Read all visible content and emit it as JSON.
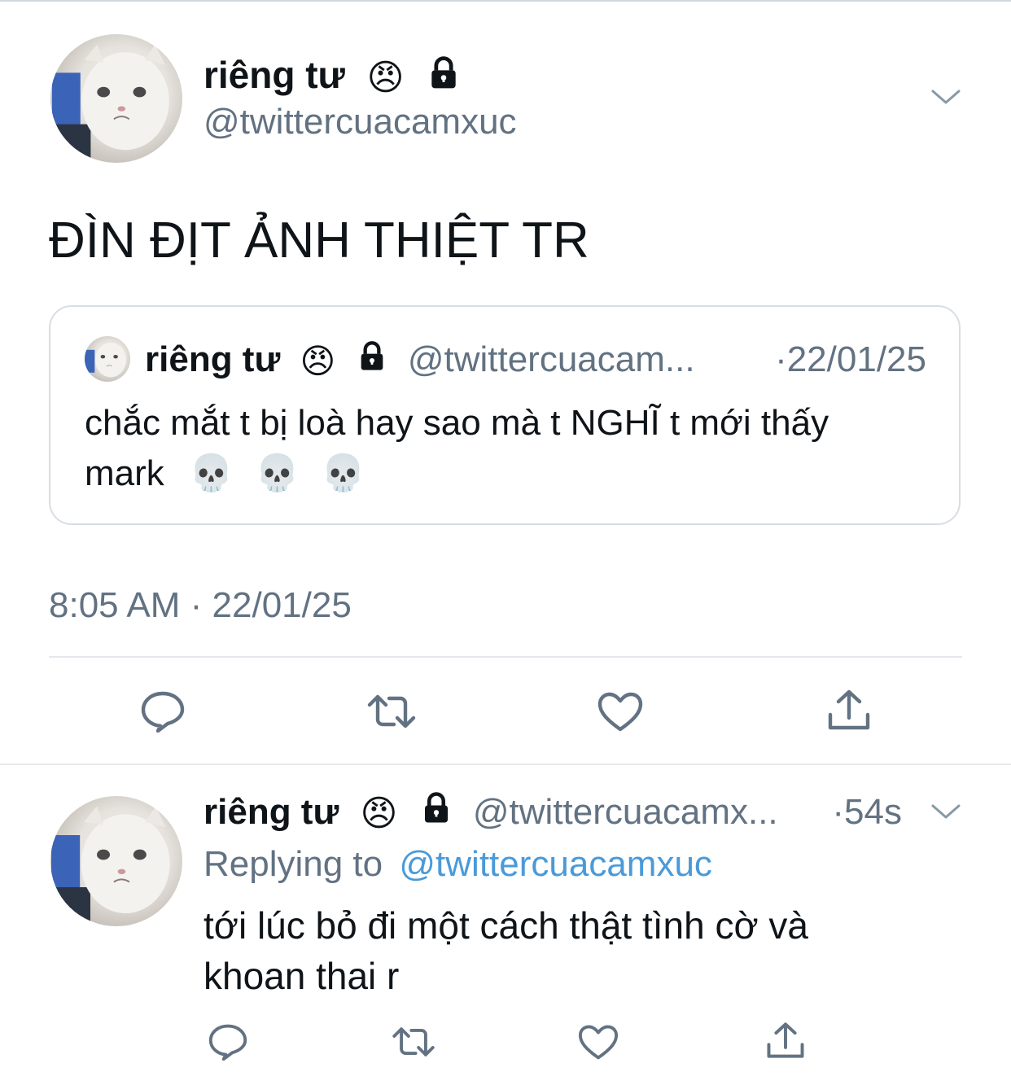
{
  "main_tweet": {
    "display_name": "riêng tư",
    "handle": "@twittercuacamxuc",
    "angry_emoji": "😠",
    "lock_icon": "lock-icon",
    "text": "ĐÌN ĐỊT ẢNH THIỆT TR",
    "timestamp": "8:05 AM · 22/01/25",
    "quoted": {
      "display_name": "riêng tư",
      "handle": "@twittercuacam...",
      "date": "·22/01/25",
      "text_line1": "chắc mắt t bị loà hay sao mà t NGHĨ t mới thấy",
      "text_line2": "mark",
      "skulls": [
        "💀",
        "💀",
        "💀"
      ]
    },
    "actions": [
      "reply-icon",
      "retweet-icon",
      "like-icon",
      "share-icon"
    ]
  },
  "reply_tweet": {
    "display_name": "riêng tư",
    "handle": "@twittercuacamx...",
    "time": "·54s",
    "replying_prefix": "Replying to",
    "replying_handle": "@twittercuacamxuc",
    "text_line1": "tới lúc bỏ đi một cách thật tình cờ và",
    "text_line2": "khoan thai r",
    "actions": [
      "reply-icon",
      "retweet-icon",
      "like-icon",
      "share-icon"
    ]
  },
  "colors": {
    "muted_text": "#627282",
    "link_blue": "#4a9ad9",
    "divider": "#e5e9ec",
    "icon_gray": "#627282"
  }
}
